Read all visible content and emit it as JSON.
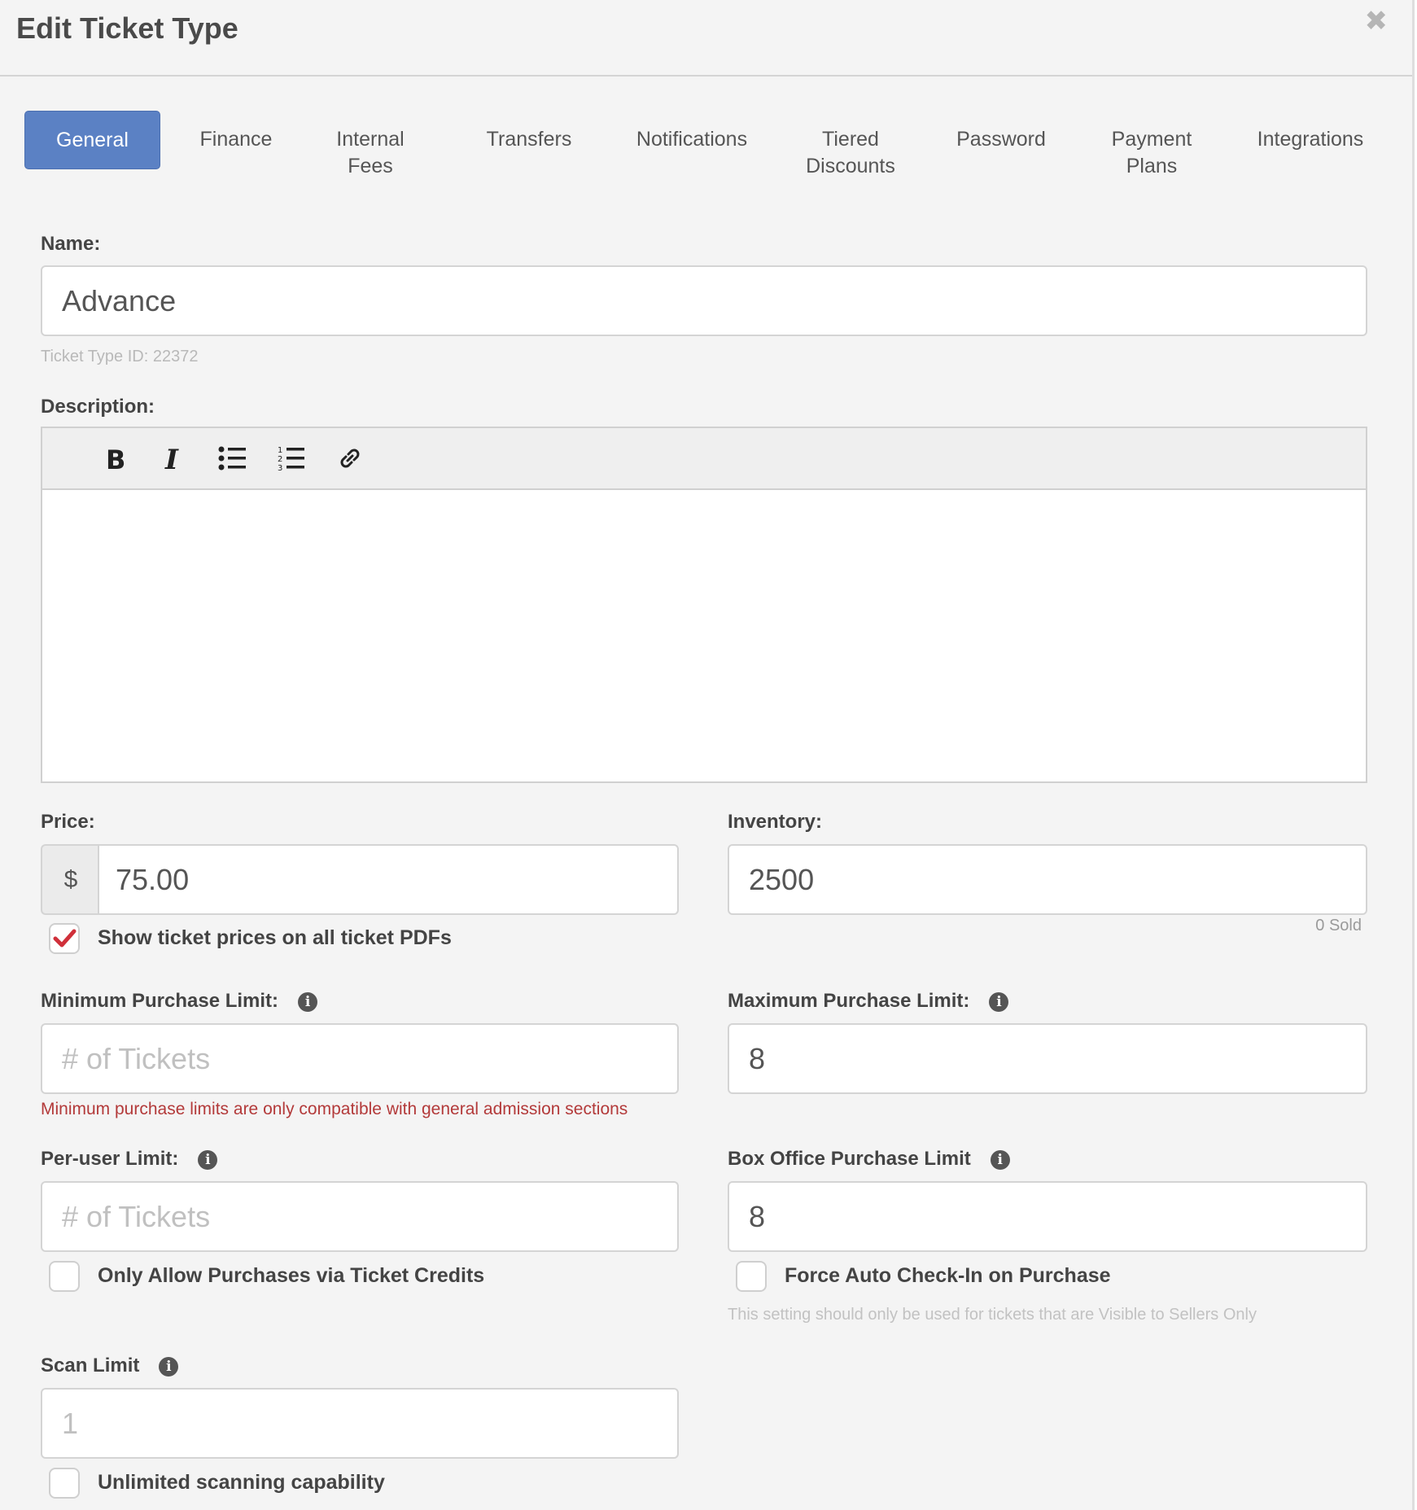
{
  "modal": {
    "title": "Edit Ticket Type"
  },
  "tabs": [
    {
      "line1": "General",
      "line2": ""
    },
    {
      "line1": "Finance",
      "line2": ""
    },
    {
      "line1": "Internal",
      "line2": "Fees"
    },
    {
      "line1": "Transfers",
      "line2": ""
    },
    {
      "line1": "Notifications",
      "line2": ""
    },
    {
      "line1": "Tiered",
      "line2": "Discounts"
    },
    {
      "line1": "Password",
      "line2": ""
    },
    {
      "line1": "Payment",
      "line2": "Plans"
    },
    {
      "line1": "Integrations",
      "line2": ""
    }
  ],
  "active_tab": "General",
  "name": {
    "label": "Name:",
    "value": "Advance",
    "helper": "Ticket Type ID: 22372"
  },
  "description": {
    "label": "Description:",
    "value": ""
  },
  "price": {
    "label": "Price:",
    "currency": "$",
    "value": "75.00"
  },
  "inventory": {
    "label": "Inventory:",
    "value": "2500",
    "sold": "0 Sold"
  },
  "show_prices": {
    "label": "Show ticket prices on all ticket PDFs",
    "checked": true
  },
  "min_limit": {
    "label": "Minimum Purchase Limit:",
    "placeholder": "# of Tickets",
    "value": "",
    "warning": "Minimum purchase limits are only compatible with general admission sections"
  },
  "max_limit": {
    "label": "Maximum Purchase Limit:",
    "value": "8"
  },
  "per_user": {
    "label": "Per-user Limit:",
    "placeholder": "# of Tickets",
    "value": ""
  },
  "box_office": {
    "label": "Box Office Purchase Limit",
    "value": "8"
  },
  "ticket_credits": {
    "label": "Only Allow Purchases via Ticket Credits",
    "checked": false
  },
  "auto_checkin": {
    "label": "Force Auto Check-In on Purchase",
    "checked": false,
    "helper": "This setting should only be used for tickets that are Visible to Sellers Only"
  },
  "scan_limit": {
    "label": "Scan Limit",
    "placeholder": "1",
    "value": ""
  },
  "unlimited_scan": {
    "label": "Unlimited scanning capability",
    "checked": false
  },
  "colors": {
    "accent": "#5b81c4",
    "warning": "#b33a3a",
    "check": "#d0303a"
  }
}
